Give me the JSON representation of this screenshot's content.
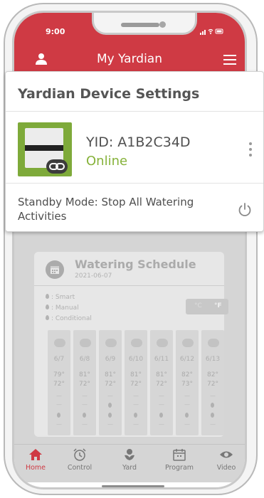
{
  "status_bar": {
    "time": "9:00",
    "icons": "signal-wifi-battery"
  },
  "header": {
    "title": "My Yardian",
    "left_icon": "user-icon",
    "right_icon": "menu-icon"
  },
  "settings_panel": {
    "title": "Yardian Device Settings",
    "device": {
      "id_label": "YID: A1B2C34D",
      "status": "Online"
    },
    "standby_label": "Standby Mode: Stop All Watering Activities"
  },
  "schedule": {
    "title": "Watering Schedule",
    "date": "2021-06-07",
    "legend": [
      ": Smart",
      ": Manual",
      ": Conditional"
    ],
    "units": {
      "c": "°C",
      "f": "°F"
    },
    "days": [
      {
        "date": "6/7",
        "high": "79°",
        "low": "72°",
        "weather": "cloud"
      },
      {
        "date": "6/8",
        "high": "81°",
        "low": "72°",
        "weather": "rain"
      },
      {
        "date": "6/9",
        "high": "81°",
        "low": "72°",
        "weather": "sun"
      },
      {
        "date": "6/10",
        "high": "81°",
        "low": "72°",
        "weather": "cloud"
      },
      {
        "date": "6/11",
        "high": "81°",
        "low": "72°",
        "weather": "rain"
      },
      {
        "date": "6/12",
        "high": "82°",
        "low": "73°",
        "weather": "sun"
      },
      {
        "date": "6/13",
        "high": "82°",
        "low": "72°",
        "weather": "sun"
      }
    ],
    "dash": "—"
  },
  "bottom_nav": [
    {
      "label": "Home",
      "icon": "home-icon"
    },
    {
      "label": "Control",
      "icon": "alarm-clock-icon"
    },
    {
      "label": "Yard",
      "icon": "plant-icon"
    },
    {
      "label": "Program",
      "icon": "calendar-icon"
    },
    {
      "label": "Video",
      "icon": "eye-icon"
    }
  ],
  "colors": {
    "brand": "#cf3a44",
    "online": "#86b23a",
    "device_bg": "#7eaa3a"
  }
}
